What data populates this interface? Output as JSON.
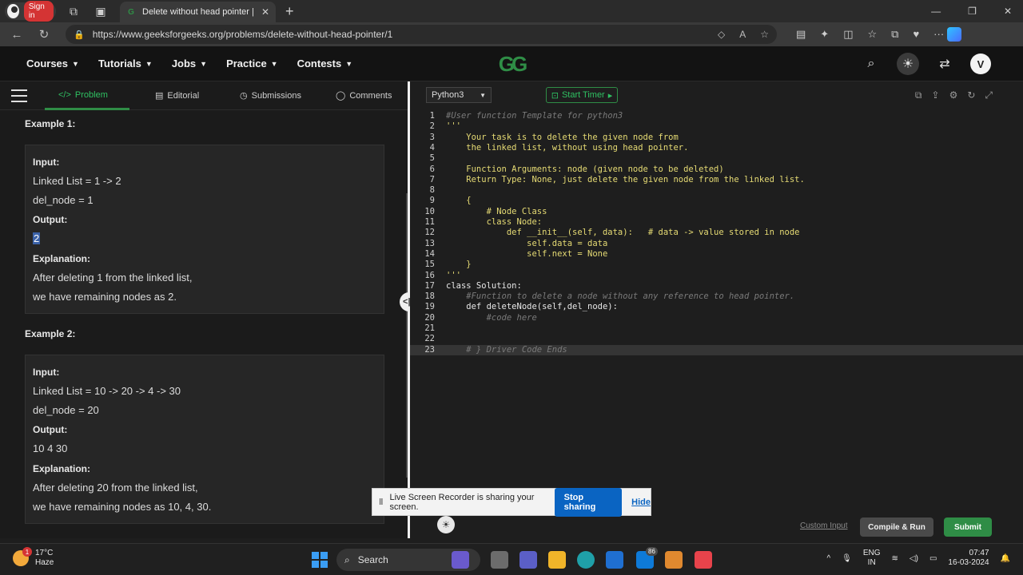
{
  "browser": {
    "signin_label": "Sign in",
    "tab_title": "Delete without head pointer | Pr",
    "url": "https://www.geeksforgeeks.org/problems/delete-without-head-pointer/1"
  },
  "header": {
    "nav": [
      {
        "label": "Courses"
      },
      {
        "label": "Tutorials"
      },
      {
        "label": "Jobs"
      },
      {
        "label": "Practice"
      },
      {
        "label": "Contests"
      }
    ],
    "logo_text": "GG",
    "user_initial": "V"
  },
  "left_tabs": {
    "problem": "Problem",
    "editorial": "Editorial",
    "submissions": "Submissions",
    "comments": "Comments"
  },
  "examples": [
    {
      "title": "Example 1:",
      "input_label": "Input:",
      "input_line1": "Linked List = 1 -> 2",
      "input_line2": "del_node = 1",
      "output_label": "Output:",
      "output_value": "2",
      "explanation_label": "Explanation:",
      "explanation_line1": "After deleting 1 from the linked list,",
      "explanation_line2": "we have remaining nodes as 2."
    },
    {
      "title": "Example 2:",
      "input_label": "Input:",
      "input_line1": "Linked List = 10 -> 20 -> 4 -> 30",
      "input_line2": "del_node = 20",
      "output_label": "Output:",
      "output_value": "10 4 30",
      "explanation_label": "Explanation:",
      "explanation_line1": "After deleting 20 from the linked list,",
      "explanation_line2": "we have remaining nodes as 10, 4, 30."
    }
  ],
  "editor": {
    "language": "Python3",
    "timer_label": "Start Timer",
    "lines": [
      {
        "n": "1",
        "t": "#User function Template for python3"
      },
      {
        "n": "2",
        "t": "'''"
      },
      {
        "n": "3",
        "t": "    Your task is to delete the given node from"
      },
      {
        "n": "4",
        "t": "    the linked list, without using head pointer."
      },
      {
        "n": "5",
        "t": ""
      },
      {
        "n": "6",
        "t": "    Function Arguments: node (given node to be deleted)"
      },
      {
        "n": "7",
        "t": "    Return Type: None, just delete the given node from the linked list."
      },
      {
        "n": "8",
        "t": ""
      },
      {
        "n": "9",
        "t": "    {"
      },
      {
        "n": "10",
        "t": "        # Node Class"
      },
      {
        "n": "11",
        "t": "        class Node:"
      },
      {
        "n": "12",
        "t": "            def __init__(self, data):   # data -> value stored in node"
      },
      {
        "n": "13",
        "t": "                self.data = data"
      },
      {
        "n": "14",
        "t": "                self.next = None"
      },
      {
        "n": "15",
        "t": "    }"
      },
      {
        "n": "16",
        "t": "'''"
      },
      {
        "n": "17",
        "t": "class Solution:"
      },
      {
        "n": "18",
        "t": "    #Function to delete a node without any reference to head pointer."
      },
      {
        "n": "19",
        "t": "    def deleteNode(self,del_node):"
      },
      {
        "n": "20",
        "t": "        #code here"
      },
      {
        "n": "21",
        "t": ""
      },
      {
        "n": "22",
        "t": ""
      },
      {
        "n": "23",
        "t": "    # } Driver Code Ends"
      }
    ],
    "custom_input": "Custom Input",
    "compile_run": "Compile & Run",
    "submit": "Submit"
  },
  "share_bar": {
    "message": "Live Screen Recorder is sharing your screen.",
    "stop": "Stop sharing",
    "hide": "Hide"
  },
  "taskbar": {
    "temp": "17°C",
    "weather": "Haze",
    "weather_badge": "1",
    "search": "Search",
    "app_badge": "86",
    "lang1": "ENG",
    "lang2": "IN",
    "time": "07:47",
    "date": "16-03-2024"
  }
}
